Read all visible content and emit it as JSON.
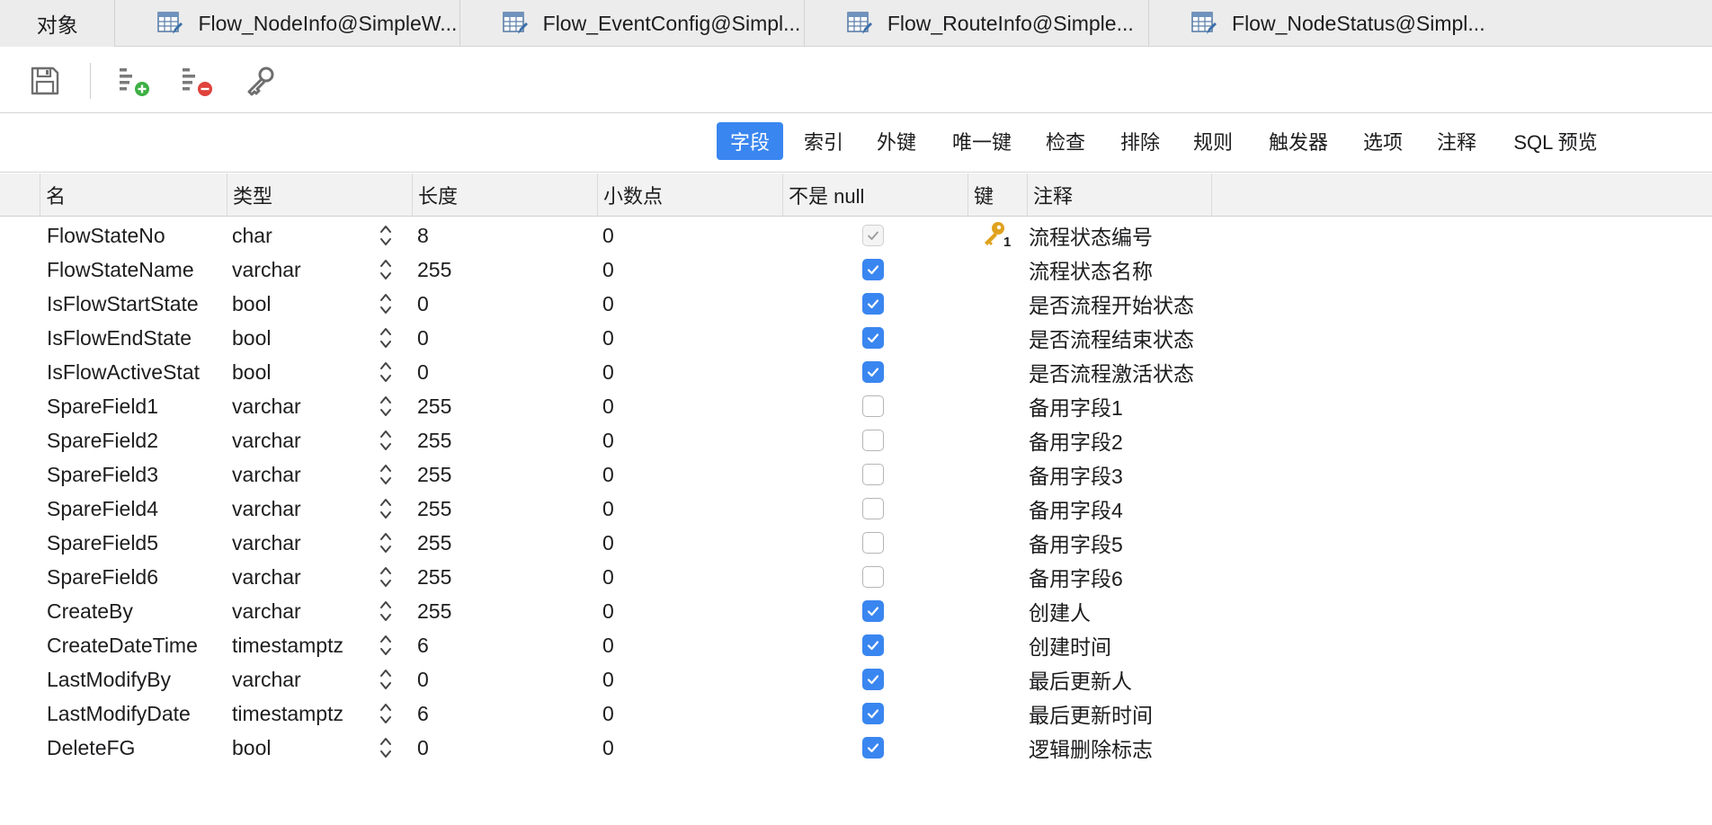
{
  "tabs": [
    {
      "label": "对象"
    },
    {
      "label": "Flow_NodeInfo@SimpleW..."
    },
    {
      "label": "Flow_EventConfig@Simpl..."
    },
    {
      "label": "Flow_RouteInfo@Simple..."
    },
    {
      "label": "Flow_NodeStatus@Simpl..."
    }
  ],
  "toolbar": {
    "icons": [
      "save-icon",
      "add-field-icon",
      "delete-field-icon",
      "primary-key-icon"
    ]
  },
  "segments": {
    "active": "字段",
    "items": [
      "字段",
      "索引",
      "外键",
      "唯一键",
      "检查",
      "排除",
      "规则",
      "触发器",
      "选项",
      "注释",
      "SQL 预览"
    ]
  },
  "columns": [
    "名",
    "类型",
    "长度",
    "小数点",
    "不是 null",
    "键",
    "注释"
  ],
  "rows": [
    {
      "name": "FlowStateNo",
      "type": "char",
      "length": "8",
      "decimals": "0",
      "not_null": true,
      "not_null_disabled": true,
      "key": "1",
      "comment": "流程状态编号"
    },
    {
      "name": "FlowStateName",
      "type": "varchar",
      "length": "255",
      "decimals": "0",
      "not_null": true,
      "key": "",
      "comment": "流程状态名称"
    },
    {
      "name": "IsFlowStartState",
      "type": "bool",
      "length": "0",
      "decimals": "0",
      "not_null": true,
      "key": "",
      "comment": "是否流程开始状态"
    },
    {
      "name": "IsFlowEndState",
      "type": "bool",
      "length": "0",
      "decimals": "0",
      "not_null": true,
      "key": "",
      "comment": "是否流程结束状态"
    },
    {
      "name": "IsFlowActiveStat",
      "type": "bool",
      "length": "0",
      "decimals": "0",
      "not_null": true,
      "key": "",
      "comment": "是否流程激活状态"
    },
    {
      "name": "SpareField1",
      "type": "varchar",
      "length": "255",
      "decimals": "0",
      "not_null": false,
      "key": "",
      "comment": "备用字段1"
    },
    {
      "name": "SpareField2",
      "type": "varchar",
      "length": "255",
      "decimals": "0",
      "not_null": false,
      "key": "",
      "comment": "备用字段2"
    },
    {
      "name": "SpareField3",
      "type": "varchar",
      "length": "255",
      "decimals": "0",
      "not_null": false,
      "key": "",
      "comment": "备用字段3"
    },
    {
      "name": "SpareField4",
      "type": "varchar",
      "length": "255",
      "decimals": "0",
      "not_null": false,
      "key": "",
      "comment": "备用字段4"
    },
    {
      "name": "SpareField5",
      "type": "varchar",
      "length": "255",
      "decimals": "0",
      "not_null": false,
      "key": "",
      "comment": "备用字段5"
    },
    {
      "name": "SpareField6",
      "type": "varchar",
      "length": "255",
      "decimals": "0",
      "not_null": false,
      "key": "",
      "comment": "备用字段6"
    },
    {
      "name": "CreateBy",
      "type": "varchar",
      "length": "255",
      "decimals": "0",
      "not_null": true,
      "key": "",
      "comment": "创建人"
    },
    {
      "name": "CreateDateTime",
      "type": "timestamptz",
      "length": "6",
      "decimals": "0",
      "not_null": true,
      "key": "",
      "comment": "创建时间"
    },
    {
      "name": "LastModifyBy",
      "type": "varchar",
      "length": "0",
      "decimals": "0",
      "not_null": true,
      "key": "",
      "comment": "最后更新人"
    },
    {
      "name": "LastModifyDate",
      "type": "timestamptz",
      "length": "6",
      "decimals": "0",
      "not_null": true,
      "key": "",
      "comment": "最后更新时间"
    },
    {
      "name": "DeleteFG",
      "type": "bool",
      "length": "0",
      "decimals": "0",
      "not_null": true,
      "key": "",
      "comment": "逻辑删除标志"
    }
  ],
  "colors": {
    "accent": "#3a86f0",
    "key_icon": "#e0a21e",
    "add_icon": "#3cb043",
    "delete_icon": "#e0413b"
  }
}
